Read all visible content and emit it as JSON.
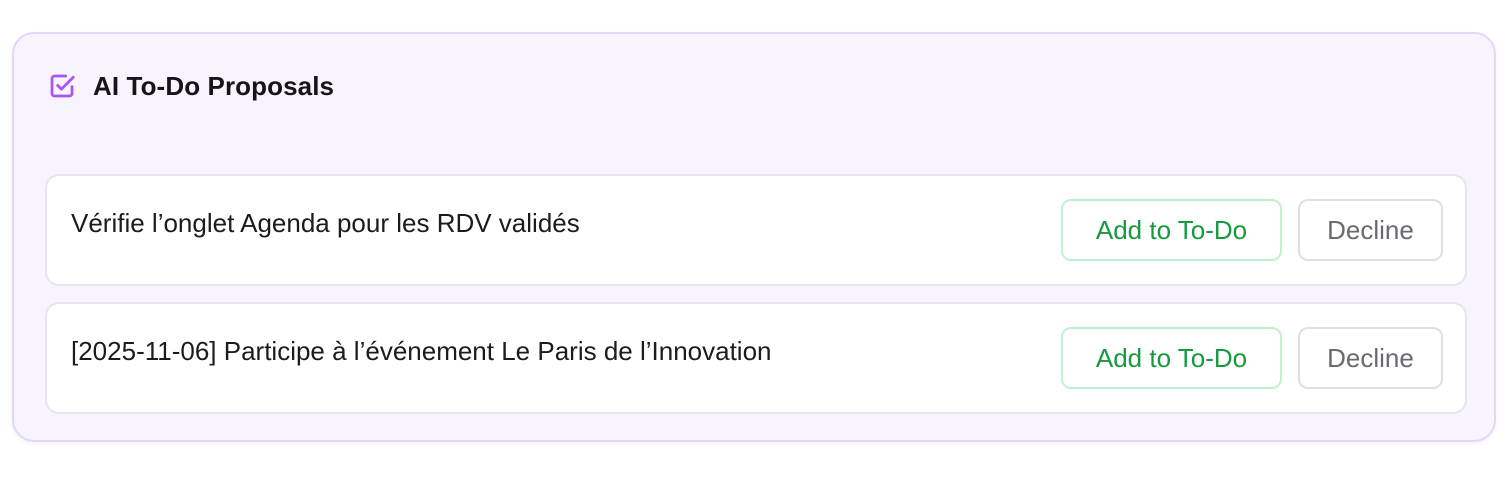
{
  "panel": {
    "title": "AI To-Do Proposals",
    "icon": "checkbox-check-icon",
    "accent_color": "#a855f7"
  },
  "proposals": [
    {
      "text": "Vérifie l’onglet Agenda pour les RDV validés",
      "add_label": "Add to To-Do",
      "decline_label": "Decline"
    },
    {
      "text": "[2025-11-06] Participe à l’événement Le Paris de l’Innovation",
      "add_label": "Add to To-Do",
      "decline_label": "Decline"
    }
  ],
  "colors": {
    "add_text": "#179a3e",
    "add_border": "#bff0cf",
    "decline_text": "#6a6870",
    "panel_bg": "#f8f4fe",
    "panel_border": "#e4d6fb"
  }
}
